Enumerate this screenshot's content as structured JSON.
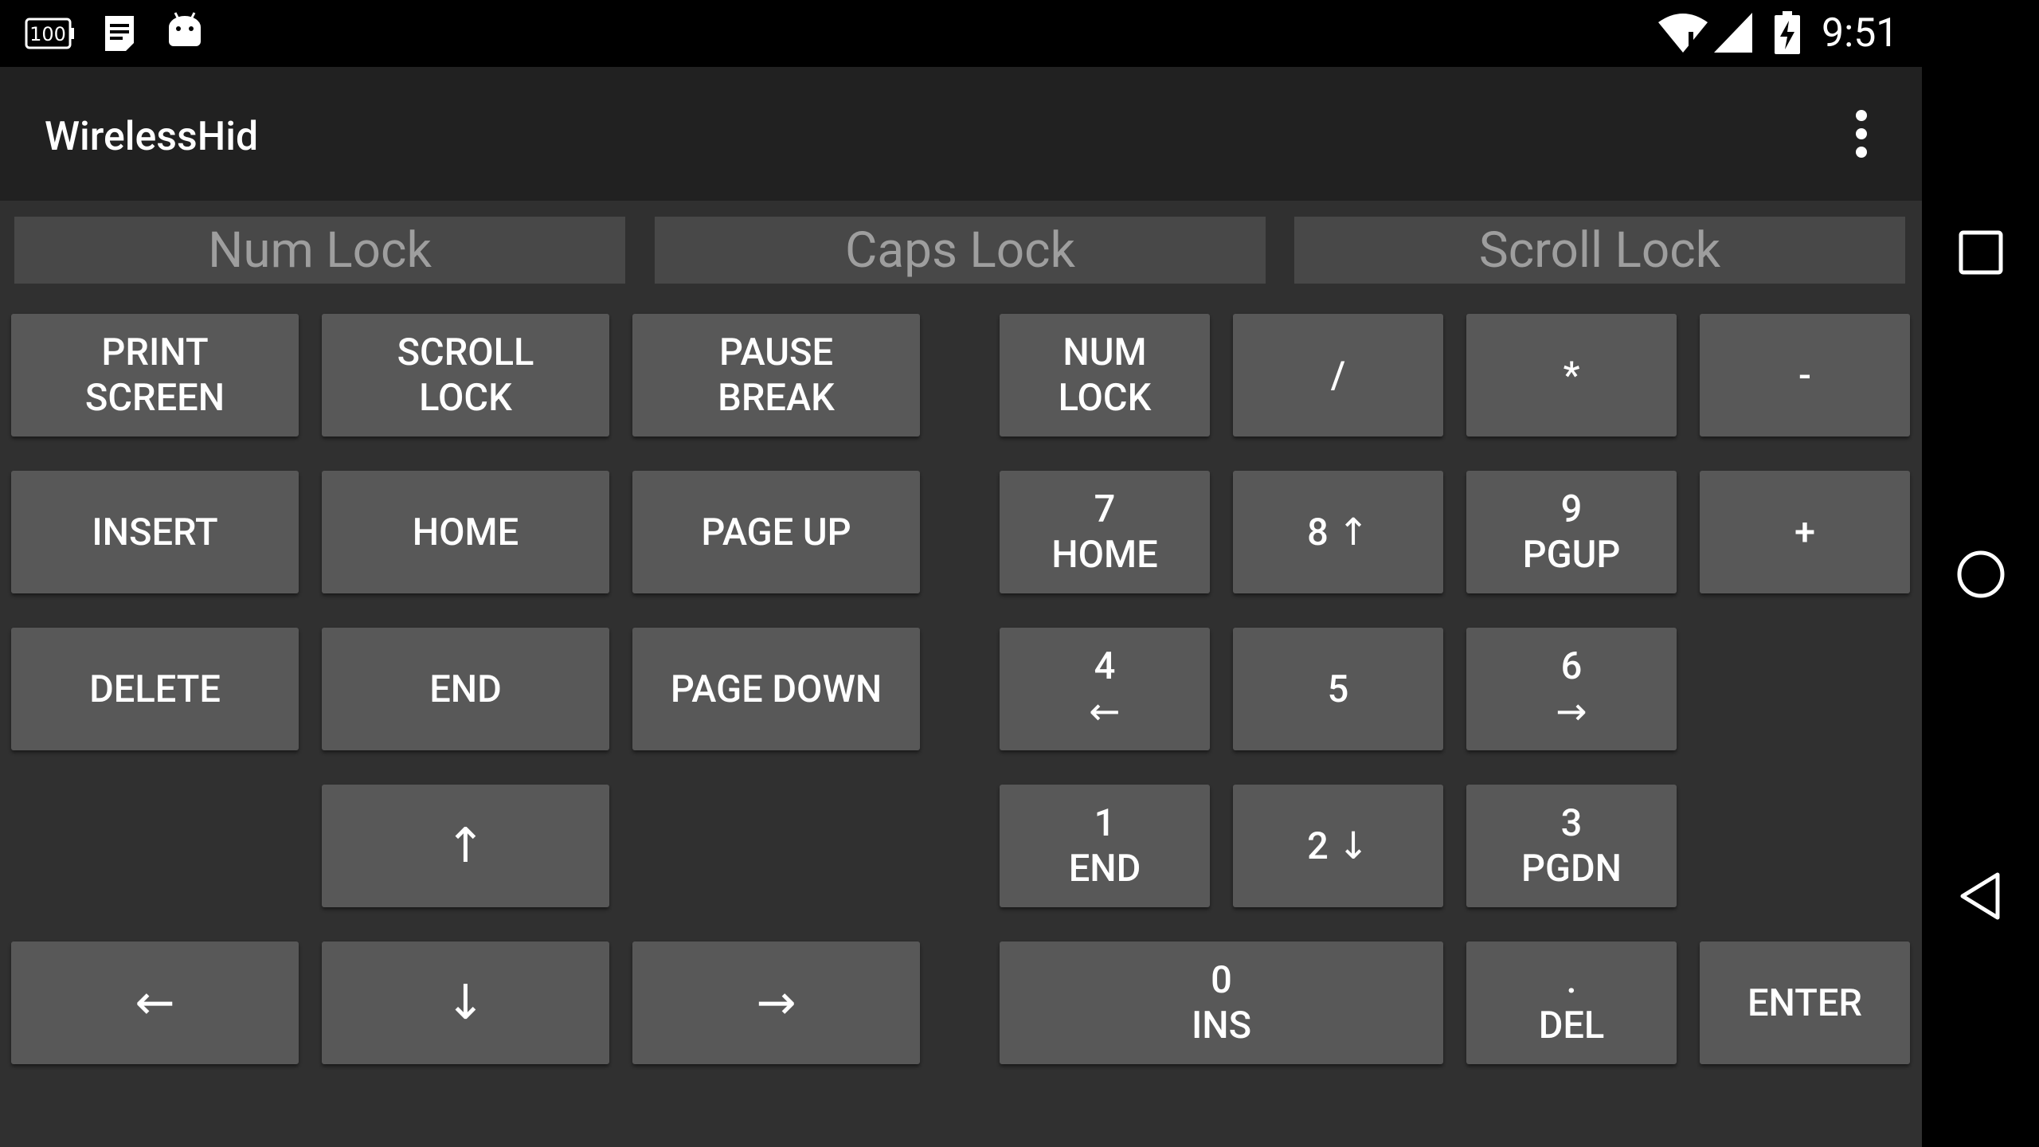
{
  "status_bar": {
    "time": "9:51",
    "icons": [
      "battery-100-icon",
      "notes-notification-icon",
      "android-debug-icon",
      "wifi-icon",
      "cell-signal-icon",
      "battery-charging-icon"
    ]
  },
  "app_bar": {
    "title": "WirelessHid",
    "menu_icon": "overflow-menu-icon"
  },
  "indicators": {
    "num_lock": "Num Lock",
    "caps_lock": "Caps Lock",
    "scroll_lock": "Scroll Lock"
  },
  "nav_keys": {
    "print_screen": [
      "PRINT",
      "SCREEN"
    ],
    "scroll_lock": [
      "SCROLL",
      "LOCK"
    ],
    "pause_break": [
      "PAUSE",
      "BREAK"
    ],
    "insert": "INSERT",
    "home": "HOME",
    "page_up": "PAGE UP",
    "delete": "DELETE",
    "end": "END",
    "page_down": "PAGE DOWN",
    "up": "↑",
    "left": "←",
    "down": "↓",
    "right": "→"
  },
  "numpad": {
    "num_lock": [
      "NUM",
      "LOCK"
    ],
    "divide": "/",
    "multiply": "*",
    "minus": "-",
    "n7": [
      "7",
      "HOME"
    ],
    "n8": "8 ↑",
    "n9": [
      "9",
      "PGUP"
    ],
    "plus": "+",
    "n4": [
      "4",
      "←"
    ],
    "n5": "5",
    "n6": [
      "6",
      "→"
    ],
    "n1": [
      "1",
      "END"
    ],
    "n2": "2 ↓",
    "n3": [
      "3",
      "PGDN"
    ],
    "n0": [
      "0",
      "INS"
    ],
    "decimal": [
      ".",
      "DEL"
    ],
    "enter": "ENTER"
  },
  "nav_bar": {
    "icons": [
      "recents-icon",
      "home-icon",
      "back-icon"
    ]
  },
  "colors": {
    "status_bar": "#000000",
    "app_bar": "#212121",
    "background": "#303030",
    "key": "#585858",
    "indicator": "#484848",
    "indicator_text": "#9e9e9e"
  }
}
